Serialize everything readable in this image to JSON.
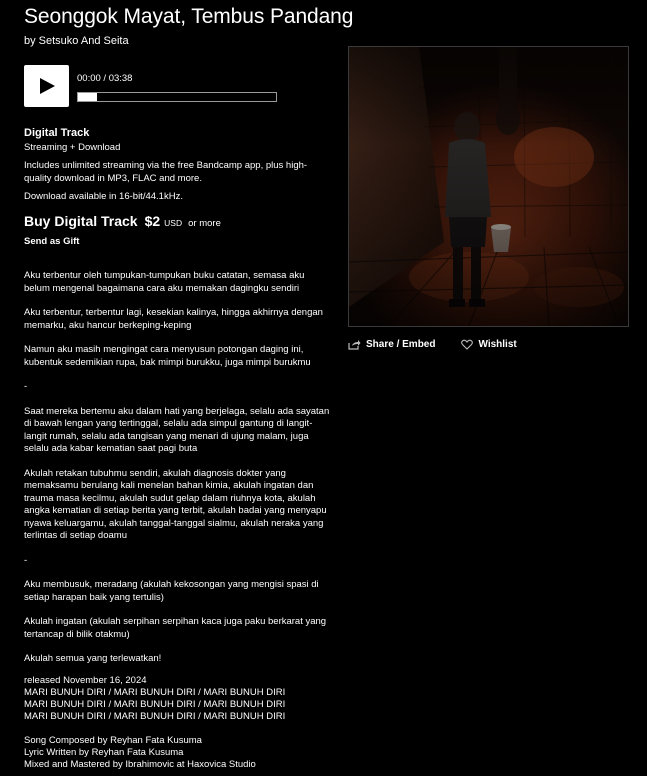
{
  "track": {
    "title": "Seonggok Mayat, Tembus Pandang",
    "artist_line": "by Setsuko And Seita"
  },
  "player": {
    "time": "00:00 / 03:38",
    "progress_fraction": 0
  },
  "digital": {
    "label": "Digital Track",
    "format": "Streaming + Download",
    "description": "Includes unlimited streaming via the free Bandcamp app, plus high-quality download in MP3, FLAC and more.",
    "quality": "Download available in 16-bit/44.1kHz.",
    "buy_label": "Buy Digital Track",
    "price": "$2",
    "currency": "USD",
    "or_more": "or more",
    "gift_label": "Send as Gift"
  },
  "lyrics": [
    "Aku terbentur oleh tumpukan-tumpukan buku catatan, semasa aku belum mengenal bagaimana cara aku memakan dagingku sendiri",
    "Aku terbentur, terbentur lagi, kesekian kalinya, hingga akhirnya dengan memarku, aku hancur berkeping-keping",
    "Namun aku masih mengingat cara menyusun potongan daging ini, kubentuk sedemikian rupa, bak mimpi burukku, juga mimpi burukmu",
    "-",
    "Saat mereka bertemu aku dalam hati yang berjelaga, selalu ada sayatan di bawah lengan yang tertinggal, selalu ada simpul gantung di langit-langit rumah, selalu ada tangisan yang menari di ujung malam, juga selalu ada kabar kematian saat pagi buta",
    "Akulah retakan tubuhmu sendiri, akulah diagnosis dokter yang memaksamu berulang kali menelan bahan kimia, akulah ingatan dan trauma masa kecilmu, akulah sudut gelap dalam riuhnya kota, akulah angka kematian di setiap berita yang terbit, akulah badai yang menyapu nyawa keluargamu, akulah tanggal-tanggal sialmu, akulah neraka yang terlintas di setiap doamu",
    "-",
    "Aku membusuk, meradang (akulah kekosongan yang mengisi spasi di setiap harapan baik yang tertulis)",
    "Akulah ingatan (akulah serpihan serpihan kaca juga paku berkarat yang tertancap di bilik otakmu)",
    "Akulah semua yang terlewatkan!"
  ],
  "credits": {
    "released": "released November 16, 2024",
    "tagline": "MARI BUNUH DIRI / MARI BUNUH DIRI / MARI BUNUH DIRI",
    "composed": "Song Composed by Reyhan Fata Kusuma",
    "lyric": "Lyric Written by Reyhan Fata Kusuma",
    "mixed": "Mixed and Mastered by Ibrahimovic at Haxovica Studio"
  },
  "actions": {
    "share_label": "Share / Embed",
    "wishlist_label": "Wishlist",
    "share_icon": "share-icon",
    "wishlist_icon": "heart-icon"
  },
  "colors": {
    "background": "#000000",
    "text": "#ffffff",
    "play_button": "#ffffff"
  }
}
